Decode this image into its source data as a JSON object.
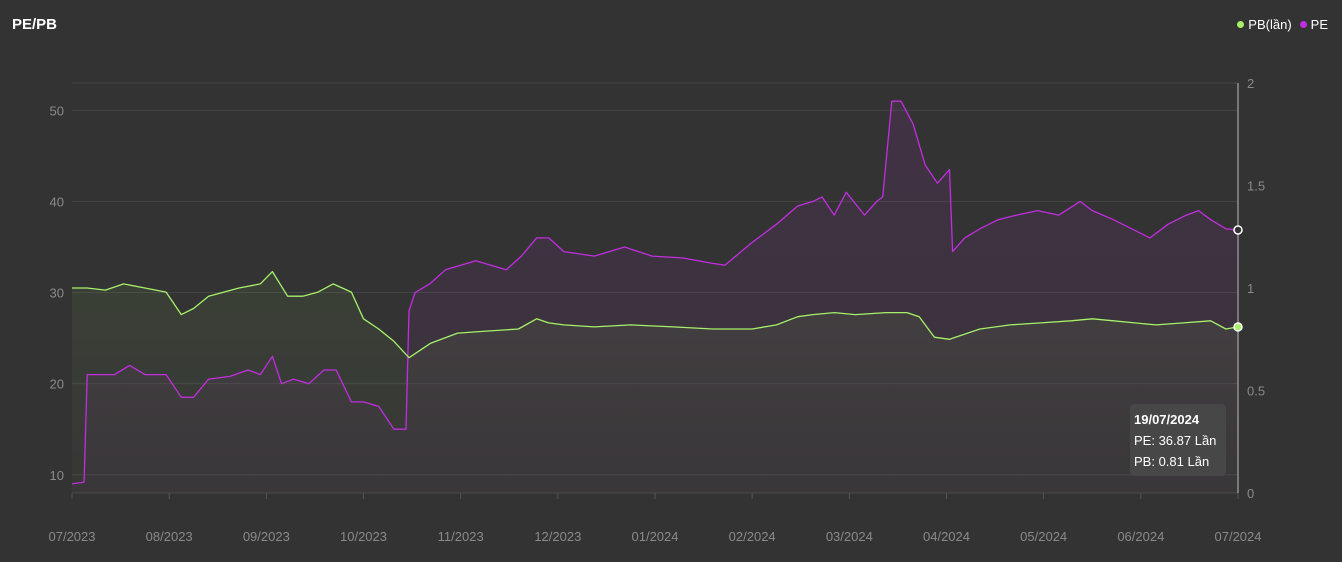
{
  "title": "PE/PB",
  "legend": [
    {
      "label": "PB(lần)",
      "color": "#a6f06a"
    },
    {
      "label": "PE",
      "color": "#c12ee0"
    }
  ],
  "tooltip": {
    "date": "19/07/2024",
    "pe_line": "PE: 36.87 Lần",
    "pb_line": "PB: 0.81 Lần"
  },
  "chart_data": {
    "type": "line",
    "x_tick_labels": [
      "07/2023",
      "08/2023",
      "09/2023",
      "10/2023",
      "11/2023",
      "12/2023",
      "01/2024",
      "02/2024",
      "03/2024",
      "04/2024",
      "05/2024",
      "06/2024",
      "07/2024"
    ],
    "left_axis": {
      "ticks": [
        "10",
        "20",
        "30",
        "40",
        "50"
      ],
      "range": [
        8,
        53
      ]
    },
    "right_axis": {
      "ticks": [
        "0",
        "0.5",
        "1",
        "1.5",
        "2"
      ],
      "range": [
        0,
        2
      ]
    },
    "grid": true,
    "legend_position": "top-right",
    "series": [
      {
        "name": "PE",
        "axis": "left",
        "color": "#c12ee0",
        "x": [
          "2023-07-01",
          "2023-07-05",
          "2023-07-06",
          "2023-07-15",
          "2023-07-20",
          "2023-07-25",
          "2023-08-01",
          "2023-08-06",
          "2023-08-10",
          "2023-08-15",
          "2023-08-22",
          "2023-08-28",
          "2023-09-01",
          "2023-09-05",
          "2023-09-08",
          "2023-09-12",
          "2023-09-17",
          "2023-09-22",
          "2023-09-26",
          "2023-10-01",
          "2023-10-05",
          "2023-10-10",
          "2023-10-15",
          "2023-10-19",
          "2023-10-20",
          "2023-10-22",
          "2023-10-27",
          "2023-11-01",
          "2023-11-06",
          "2023-11-11",
          "2023-11-16",
          "2023-11-21",
          "2023-11-26",
          "2023-12-01",
          "2023-12-05",
          "2023-12-10",
          "2023-12-20",
          "2023-12-30",
          "2024-01-08",
          "2024-01-18",
          "2024-01-28",
          "2024-02-01",
          "2024-02-10",
          "2024-02-18",
          "2024-02-25",
          "2024-03-01",
          "2024-03-04",
          "2024-03-08",
          "2024-03-12",
          "2024-03-18",
          "2024-03-22",
          "2024-03-24",
          "2024-03-27",
          "2024-03-30",
          "2024-04-03",
          "2024-04-07",
          "2024-04-11",
          "2024-04-15",
          "2024-04-16",
          "2024-04-20",
          "2024-04-25",
          "2024-05-01",
          "2024-05-07",
          "2024-05-14",
          "2024-05-21",
          "2024-05-28",
          "2024-06-01",
          "2024-06-08",
          "2024-06-14",
          "2024-06-20",
          "2024-06-26",
          "2024-07-02",
          "2024-07-06",
          "2024-07-10",
          "2024-07-15",
          "2024-07-19"
        ],
        "values": [
          9.0,
          9.2,
          21.0,
          21.0,
          22.0,
          21.0,
          21.0,
          18.5,
          18.5,
          20.5,
          20.8,
          21.5,
          21.0,
          23.0,
          20.0,
          20.5,
          20.0,
          21.5,
          21.5,
          18.0,
          18.0,
          17.5,
          15.0,
          15.0,
          28.0,
          30.0,
          31.0,
          32.5,
          33.0,
          33.5,
          33.0,
          32.5,
          34.0,
          36.0,
          36.0,
          34.5,
          34.0,
          35.0,
          34.0,
          33.8,
          33.2,
          33.0,
          35.5,
          37.5,
          39.5,
          40.0,
          40.5,
          38.5,
          41.0,
          38.5,
          40.0,
          40.5,
          51.0,
          51.0,
          48.5,
          44.0,
          42.0,
          43.5,
          34.5,
          36.0,
          37.0,
          38.0,
          38.5,
          39.0,
          38.5,
          40.0,
          39.0,
          38.0,
          37.0,
          36.0,
          37.5,
          38.5,
          39.0,
          38.0,
          37.0,
          36.87
        ]
      },
      {
        "name": "PB(lần)",
        "axis": "right",
        "color": "#a6f06a",
        "x": [
          "2023-07-01",
          "2023-07-06",
          "2023-07-12",
          "2023-07-18",
          "2023-07-25",
          "2023-08-01",
          "2023-08-06",
          "2023-08-10",
          "2023-08-15",
          "2023-08-20",
          "2023-08-25",
          "2023-09-01",
          "2023-09-05",
          "2023-09-10",
          "2023-09-15",
          "2023-09-20",
          "2023-09-25",
          "2023-10-01",
          "2023-10-05",
          "2023-10-10",
          "2023-10-15",
          "2023-10-20",
          "2023-10-27",
          "2023-11-05",
          "2023-11-15",
          "2023-11-25",
          "2023-12-01",
          "2023-12-05",
          "2023-12-10",
          "2023-12-20",
          "2024-01-01",
          "2024-01-15",
          "2024-01-28",
          "2024-02-10",
          "2024-02-18",
          "2024-02-25",
          "2024-03-01",
          "2024-03-08",
          "2024-03-15",
          "2024-03-25",
          "2024-04-01",
          "2024-04-05",
          "2024-04-10",
          "2024-04-15",
          "2024-04-25",
          "2024-05-05",
          "2024-05-15",
          "2024-05-25",
          "2024-06-01",
          "2024-06-08",
          "2024-06-15",
          "2024-06-22",
          "2024-07-01",
          "2024-07-10",
          "2024-07-15",
          "2024-07-19"
        ],
        "values": [
          1.0,
          1.0,
          0.99,
          1.02,
          1.0,
          0.98,
          0.87,
          0.9,
          0.96,
          0.98,
          1.0,
          1.02,
          1.08,
          0.96,
          0.96,
          0.98,
          1.02,
          0.98,
          0.85,
          0.8,
          0.74,
          0.66,
          0.73,
          0.78,
          0.79,
          0.8,
          0.85,
          0.83,
          0.82,
          0.81,
          0.82,
          0.81,
          0.8,
          0.8,
          0.82,
          0.86,
          0.87,
          0.88,
          0.87,
          0.88,
          0.88,
          0.86,
          0.76,
          0.75,
          0.8,
          0.82,
          0.83,
          0.84,
          0.85,
          0.84,
          0.83,
          0.82,
          0.83,
          0.84,
          0.8,
          0.81
        ]
      }
    ]
  }
}
